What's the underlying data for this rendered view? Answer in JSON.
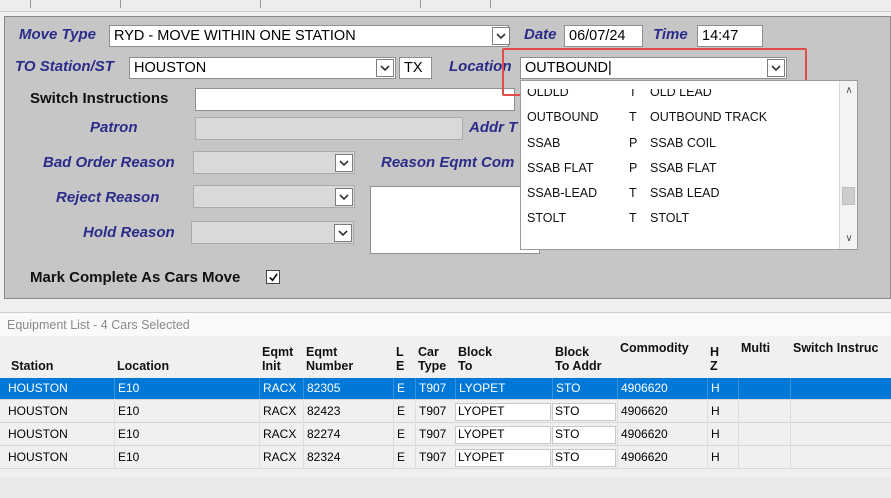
{
  "form": {
    "move_type_label": "Move Type",
    "move_type_value": "RYD - MOVE WITHIN ONE STATION",
    "date_label": "Date",
    "date_value": "06/07/24",
    "time_label": "Time",
    "time_value": "14:47",
    "to_station_label": "TO Station/ST",
    "to_station_value": "HOUSTON",
    "state_value": "TX",
    "location_label": "Location",
    "location_value": "OUTBOUND",
    "switch_instructions_label": "Switch Instructions",
    "patron_label": "Patron",
    "addr_label": "Addr T",
    "bad_order_label": "Bad Order Reason",
    "reason_eqmt_label": "Reason Eqmt Com",
    "reject_label": "Reject Reason",
    "hold_label": "Hold Reason",
    "mark_complete_label": "Mark Complete As Cars Move",
    "mark_complete_checked": true
  },
  "location_dropdown": {
    "items": [
      {
        "code": "OLDLD",
        "type": "T",
        "desc": "OLD LEAD"
      },
      {
        "code": "OUTBOUND",
        "type": "T",
        "desc": "OUTBOUND TRACK"
      },
      {
        "code": "SSAB",
        "type": "P",
        "desc": "SSAB COIL"
      },
      {
        "code": "SSAB FLAT",
        "type": "P",
        "desc": "SSAB FLAT"
      },
      {
        "code": "SSAB-LEAD",
        "type": "T",
        "desc": "SSAB LEAD"
      },
      {
        "code": "STOLT",
        "type": "T",
        "desc": "STOLT"
      }
    ]
  },
  "equipment": {
    "title": "Equipment List - 4 Cars Selected",
    "headers": {
      "station": "Station",
      "location": "Location",
      "eqmt_init_1": "Eqmt",
      "eqmt_init_2": "Init",
      "eqmt_num_1": "Eqmt",
      "eqmt_num_2": "Number",
      "le_1": "L",
      "le_2": "E",
      "car_1": "Car",
      "car_2": "Type",
      "block_1": "Block",
      "block_2": "To",
      "bta_1": "Block",
      "bta_2": "To Addr",
      "commodity": "Commodity",
      "hz_1": "H",
      "hz_2": "Z",
      "multi": "Multi",
      "switch": "Switch Instruc"
    },
    "rows": [
      {
        "station": "HOUSTON",
        "location": "E10",
        "init": "RACX",
        "number": "82305",
        "le": "E",
        "car": "T907",
        "block": "LYOPET",
        "addr": "STO",
        "commodity": "4906620",
        "hz": "H"
      },
      {
        "station": "HOUSTON",
        "location": "E10",
        "init": "RACX",
        "number": "82423",
        "le": "E",
        "car": "T907",
        "block": "LYOPET",
        "addr": "STO",
        "commodity": "4906620",
        "hz": "H"
      },
      {
        "station": "HOUSTON",
        "location": "E10",
        "init": "RACX",
        "number": "82274",
        "le": "E",
        "car": "T907",
        "block": "LYOPET",
        "addr": "STO",
        "commodity": "4906620",
        "hz": "H"
      },
      {
        "station": "HOUSTON",
        "location": "E10",
        "init": "RACX",
        "number": "82324",
        "le": "E",
        "car": "T907",
        "block": "LYOPET",
        "addr": "STO",
        "commodity": "4906620",
        "hz": "H"
      }
    ]
  },
  "colors": {
    "label_blue": "#2b2b8a",
    "selection_blue": "#0078d7",
    "highlight_red": "#e04b4b"
  },
  "icons": {
    "dropdown": "chevron-down-icon",
    "check": "checkmark-icon"
  }
}
